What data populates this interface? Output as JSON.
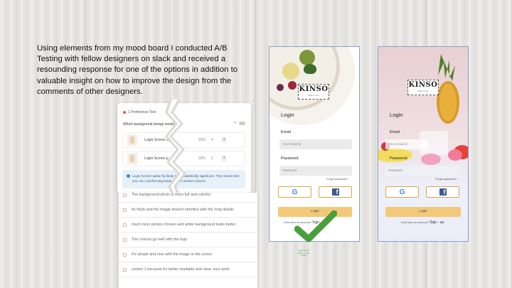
{
  "description": "Using elements from my mood board I conducted A/B Testing with fellow designers on slack and received a resounding response for one of the options in addition to valuable insight on how to improve the design from the comments of other designers.",
  "preference_test": {
    "header": "1 Preference Test",
    "question": "Which background design would y",
    "options": [
      {
        "name": "Login Screen op",
        "pct": "92%",
        "votes": "4"
      },
      {
        "name": "Login Screen.p",
        "pct": "18%",
        "votes": "2"
      }
    ],
    "help": "?",
    "note": "Login Screen option         tly likely to be statistically significant. This means that you can          s performing better due to random chance."
  },
  "comments": [
    "The background photo is more full and colorful",
    "Its fresh and the image doesn't interfere with the long details",
    "much nicer picture chosen and white background looks better",
    "The colours go well with the logo",
    "It's simple and nice with the image in the corner",
    "screen 1 because it's better readable and clear. nice work."
  ],
  "phone1": {
    "logo": "KINSO",
    "logo_sub": "Make it with",
    "title": "Login",
    "email_label": "Email",
    "email_placeholder": "Your email id",
    "password_label": "Password",
    "password_placeholder": "Password",
    "forgot": "Forgot password?",
    "login_button": "Login",
    "signup_prefix": "Dont have an account?",
    "signup_link": "Sign - up"
  },
  "phone2": {
    "logo": "KINSO",
    "logo_sub": "Make it with",
    "title": "Login",
    "email_label": "Email",
    "email_placeholder": "Your email id",
    "password_label": "Password",
    "password_placeholder": "Password",
    "forgot": "Forgot password?",
    "login_button": "Login",
    "signup_prefix": "Dont have an account?",
    "signup_link": "Sign - up"
  },
  "checkmark_caption": "Login Screen Option 1 best layout",
  "colors": {
    "accent_button": "#f3c979",
    "check_green": "#4a9e3c",
    "facebook": "#3b5998",
    "google": "#4285f4"
  }
}
